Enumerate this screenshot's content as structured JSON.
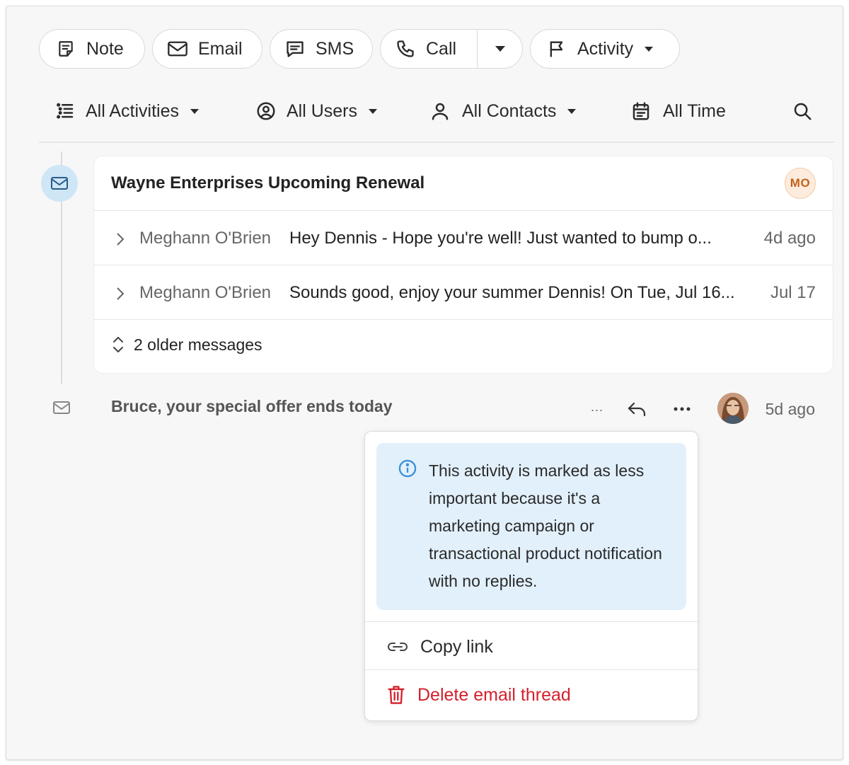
{
  "actions": {
    "note": "Note",
    "email": "Email",
    "sms": "SMS",
    "call": "Call",
    "activity": "Activity"
  },
  "filters": {
    "activities": "All Activities",
    "users": "All Users",
    "contacts": "All Contacts",
    "time": "All Time"
  },
  "thread": {
    "title": "Wayne Enterprises Upcoming Renewal",
    "owner_initials": "MO",
    "messages": [
      {
        "sender": "Meghann O'Brien",
        "snippet": "Hey Dennis - Hope you're well! Just wanted to bump o...",
        "time": "4d ago"
      },
      {
        "sender": "Meghann O'Brien",
        "snippet": "Sounds good, enjoy your summer Dennis! On Tue, Jul 16...",
        "time": "Jul 17"
      }
    ],
    "older_label": "2 older messages"
  },
  "activity2": {
    "title": "Bruce, your special offer ends today",
    "ellipsis": "...",
    "time": "5d ago"
  },
  "menu": {
    "info": "This activity is marked as less important because it's a marketing campaign or transactional product notification with no replies.",
    "copy_link": "Copy link",
    "delete_thread": "Delete email thread"
  },
  "colors": {
    "accent_blue": "#cfe6f7",
    "info_bg": "#e2f0fb",
    "danger": "#d4202c",
    "badge_text": "#c2611a"
  }
}
